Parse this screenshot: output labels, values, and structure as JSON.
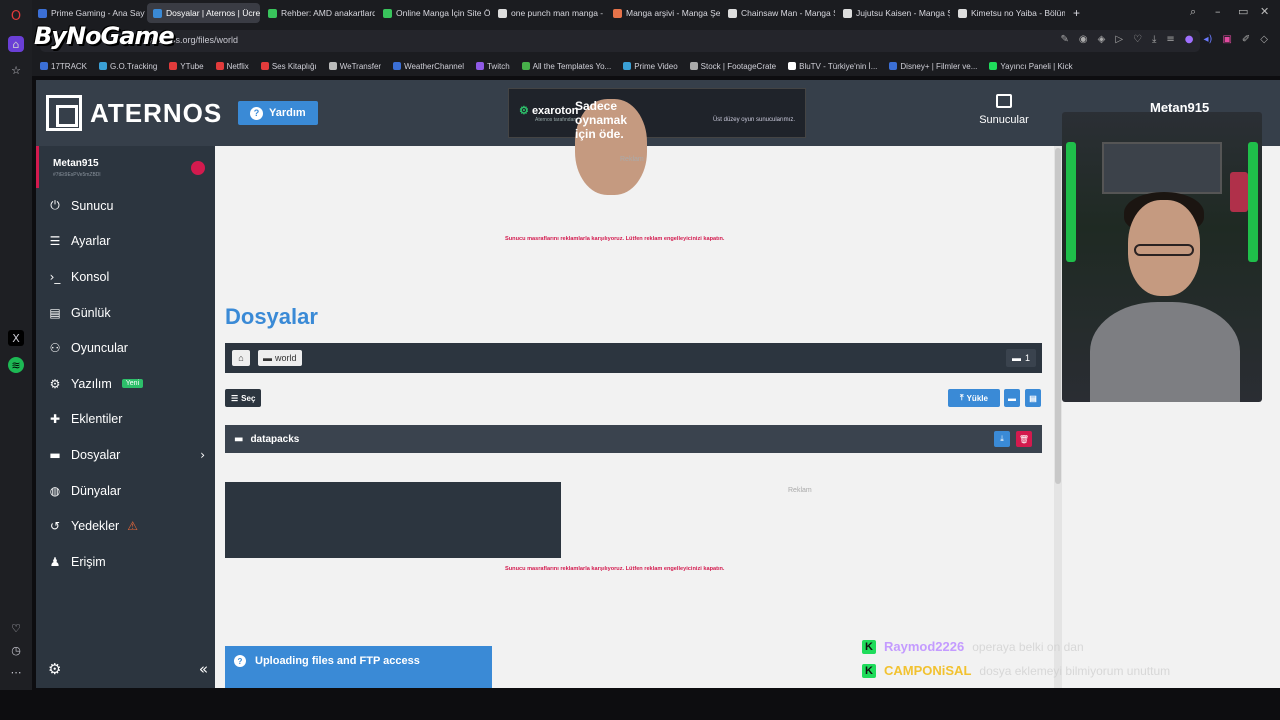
{
  "browser": {
    "address_url": "aternos.org/files/world",
    "overlay_logo": "ByNoGame",
    "tabs": [
      {
        "label": "Prime Gaming - Ana Sayfa",
        "color": "#3b6fd6",
        "active": false
      },
      {
        "label": "Dosyalar | Aternos | Ücret",
        "color": "#3a8ad6",
        "active": true
      },
      {
        "label": "Rehber: AMD anakartlarda",
        "color": "#39c45c",
        "active": false
      },
      {
        "label": "Online Manga İçin Site Ö",
        "color": "#39c45c",
        "active": false
      },
      {
        "label": "one punch man manga -",
        "color": "#dddddd",
        "active": false
      },
      {
        "label": "Manga arşivi - Manga Şe",
        "color": "#e6734a",
        "active": false
      },
      {
        "label": "Chainsaw Man - Manga Ş",
        "color": "#dddddd",
        "active": false
      },
      {
        "label": "Jujutsu Kaisen - Manga Ş",
        "color": "#dddddd",
        "active": false
      },
      {
        "label": "Kimetsu no Yaiba - Bölüm",
        "color": "#dddddd",
        "active": false
      }
    ],
    "bookmarks": [
      {
        "label": "17TRACK",
        "color": "#3b6fd6"
      },
      {
        "label": "G.O.Tracking",
        "color": "#3aa0d6"
      },
      {
        "label": "YTube",
        "color": "#e23b3b"
      },
      {
        "label": "Netflix",
        "color": "#e23b3b"
      },
      {
        "label": "Ses Kitaplığı",
        "color": "#e23b3b"
      },
      {
        "label": "WeTransfer",
        "color": "#bbbbbb"
      },
      {
        "label": "WeatherChannel",
        "color": "#3b6fd6"
      },
      {
        "label": "Twitch",
        "color": "#8f5ae6"
      },
      {
        "label": "All the Templates Yo...",
        "color": "#47b04a"
      },
      {
        "label": "Prime Video",
        "color": "#3aa0d6"
      },
      {
        "label": "Stock | FootageCrate",
        "color": "#aaaaaa"
      },
      {
        "label": "BluTV - Türkiye'nin İ...",
        "color": "#ffffff"
      },
      {
        "label": "Disney+ | Filmler ve...",
        "color": "#3b6fd6"
      },
      {
        "label": "Yayıncı Paneli | Kick",
        "color": "#1fdc5b"
      }
    ]
  },
  "header": {
    "brand": "ATERNOS",
    "help_label": "Yardım",
    "banner_brand": "exaroton",
    "banner_brand_sub": "Aternos tarafından",
    "banner_headline": "Sadece oynamak için öde.",
    "banner_sub": "Üst düzey oyun sunucularımız.",
    "servers_label": "Sunucular",
    "username": "Metan915"
  },
  "sidebar": {
    "server_name": "Metan915",
    "server_id": "#7tEt9EsPVe5mZBDl",
    "items": [
      {
        "label": "Sunucu",
        "icon": "power-icon",
        "glyph": "⏻"
      },
      {
        "label": "Ayarlar",
        "icon": "list-icon",
        "glyph": "☰"
      },
      {
        "label": "Konsol",
        "icon": "terminal-icon",
        "glyph": "›_"
      },
      {
        "label": "Günlük",
        "icon": "file-icon",
        "glyph": "▤"
      },
      {
        "label": "Oyuncular",
        "icon": "users-icon",
        "glyph": "⚇"
      },
      {
        "label": "Yazılım",
        "icon": "gears-icon",
        "glyph": "⚙"
      },
      {
        "label": "Eklentiler",
        "icon": "puzzle-icon",
        "glyph": "✚"
      },
      {
        "label": "Dosyalar",
        "icon": "folder-icon",
        "glyph": "▬"
      },
      {
        "label": "Dünyalar",
        "icon": "globe-icon",
        "glyph": "◍"
      },
      {
        "label": "Yedekler",
        "icon": "history-icon",
        "glyph": "↺"
      },
      {
        "label": "Erişim",
        "icon": "user-icon",
        "glyph": "♟"
      }
    ],
    "new_badge": "Yeni",
    "collapse_glyph": "«"
  },
  "main": {
    "ad_label": "Reklam",
    "ad_message": "Sunucu masraflarını reklamlarla karşılıyoruz. Lütfen reklam engelleyicinizi kapatın.",
    "title": "Dosyalar",
    "breadcrumb_folder": "world",
    "folder_count": "1",
    "select_label": "Seç",
    "upload_label": "Yükle",
    "files": [
      {
        "name": "datapacks"
      }
    ],
    "ftp_title": "Uploading files and FTP access"
  },
  "chat": [
    {
      "user": "Raymod2226",
      "user_color": "#c49bff",
      "message": "operaya belki on dan"
    },
    {
      "user": "CAMPONiSAL",
      "user_color": "#f2c230",
      "message": "dosya eklemeyi bilmiyorum unuttum"
    }
  ],
  "colors": {
    "accent": "#3a8ad6",
    "danger": "#d31a4e",
    "sidebar_bg": "#2c353f",
    "header_bg": "#363f4a"
  }
}
